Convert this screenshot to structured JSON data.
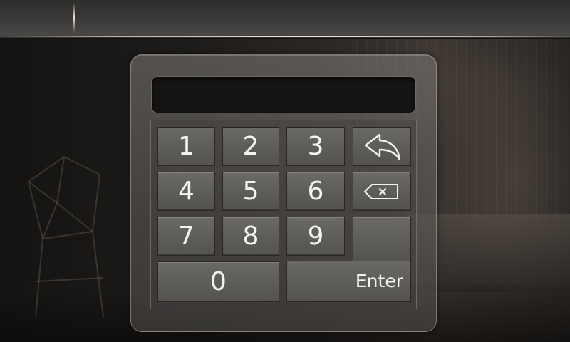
{
  "display": {
    "value": ""
  },
  "keypad": {
    "digits": [
      "1",
      "2",
      "3",
      "4",
      "5",
      "6",
      "7",
      "8",
      "9",
      "0"
    ],
    "enter_label": "Enter",
    "back_icon": "back-arrow-icon",
    "delete_icon": "backspace-icon"
  },
  "colors": {
    "key_face": "#5e5c59",
    "display_bg": "#151413",
    "label": "#f4f3f1"
  }
}
